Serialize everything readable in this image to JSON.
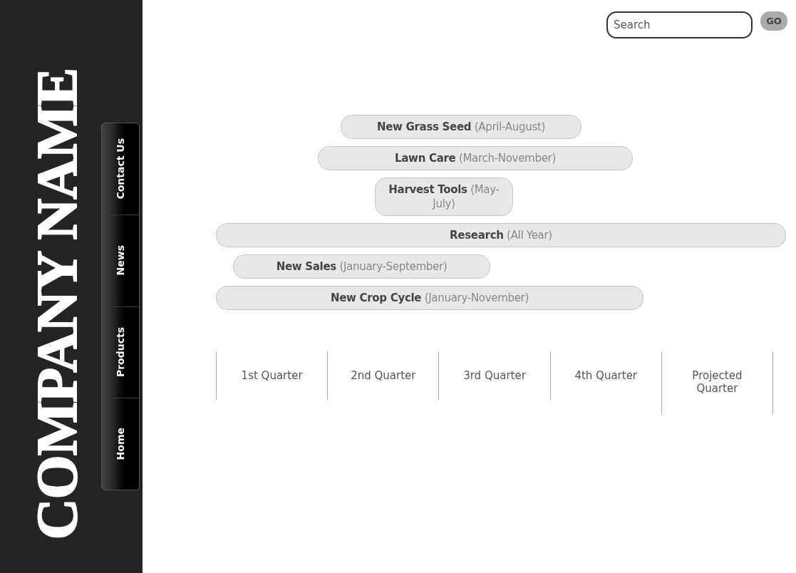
{
  "sidebar": {
    "logo": "COMPANY NAME",
    "nav": [
      {
        "label": "Home"
      },
      {
        "label": "Products"
      },
      {
        "label": "News"
      },
      {
        "label": "Contact Us"
      }
    ]
  },
  "search": {
    "placeholder": "Search",
    "button": "GO"
  },
  "timeline": {
    "bars": [
      {
        "title": "New Grass Seed",
        "period": "(April-August)"
      },
      {
        "title": "Lawn Care",
        "period": "(March-November)"
      },
      {
        "title": "Harvest Tools",
        "period": "(May-July)"
      },
      {
        "title": "Research",
        "period": "(All Year)"
      },
      {
        "title": "New Sales",
        "period": "(January-September)"
      },
      {
        "title": "New Crop Cycle",
        "period": "(January-November)"
      }
    ],
    "quarters": [
      "1st Quarter",
      "2nd Quarter",
      "3rd Quarter",
      "4th Quarter",
      "Projected Quarter"
    ]
  }
}
